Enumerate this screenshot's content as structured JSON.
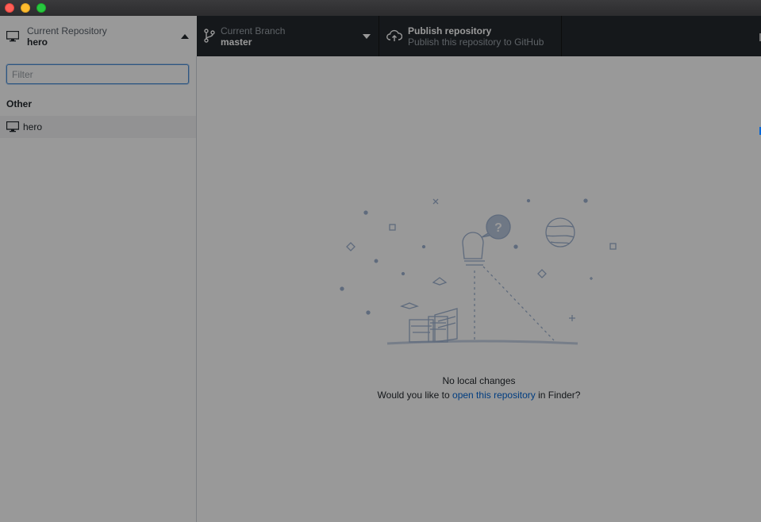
{
  "window": {
    "traffic_lights": [
      "close",
      "minimize",
      "zoom"
    ]
  },
  "toolbar": {
    "branch": {
      "title": "Current Branch",
      "value": "master",
      "icon": "git-branch-icon"
    },
    "publish": {
      "title": "Publish repository",
      "subtitle": "Publish this repository to GitHub",
      "icon": "cloud-upload-icon"
    }
  },
  "sidebar": {
    "current_repo_label": "Current Repository",
    "current_repo_value": "hero",
    "filter_placeholder": "Filter",
    "group_label": "Other",
    "repos": [
      {
        "name": "hero",
        "icon": "desktop-icon"
      }
    ]
  },
  "blankslate": {
    "line1": "No local changes",
    "line2_prefix": "Would you like to ",
    "line2_link": "open this repository",
    "line2_suffix": " in Finder?"
  },
  "colors": {
    "toolbar_bg": "#24292e",
    "link": "#0366d6",
    "focus": "#4a90d9"
  }
}
